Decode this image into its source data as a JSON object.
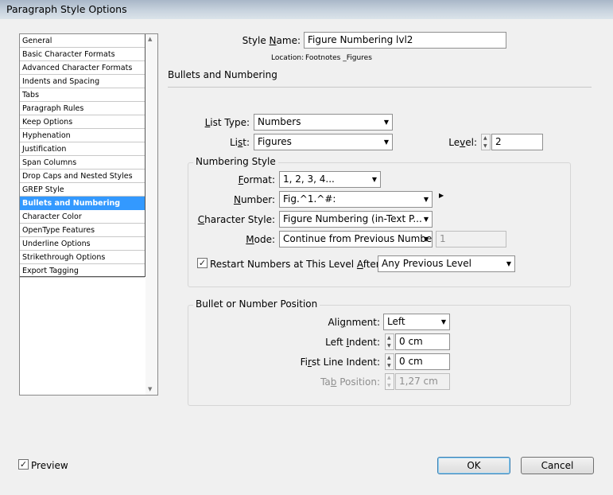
{
  "window": {
    "title": "Paragraph Style Options"
  },
  "sidebar": {
    "items": [
      {
        "label": "General"
      },
      {
        "label": "Basic Character Formats"
      },
      {
        "label": "Advanced Character Formats"
      },
      {
        "label": "Indents and Spacing"
      },
      {
        "label": "Tabs"
      },
      {
        "label": "Paragraph Rules"
      },
      {
        "label": "Keep Options"
      },
      {
        "label": "Hyphenation"
      },
      {
        "label": "Justification"
      },
      {
        "label": "Span Columns"
      },
      {
        "label": "Drop Caps and Nested Styles"
      },
      {
        "label": "GREP Style"
      },
      {
        "label": "Bullets and Numbering",
        "selected": true
      },
      {
        "label": "Character Color"
      },
      {
        "label": "OpenType Features"
      },
      {
        "label": "Underline Options"
      },
      {
        "label": "Strikethrough Options"
      },
      {
        "label": "Export Tagging"
      }
    ]
  },
  "header": {
    "style_name_label_pre": "Style ",
    "style_name_label_u": "N",
    "style_name_label_post": "ame:",
    "style_name_value": "Figure Numbering lvl2",
    "location_label": "Location:",
    "location_value": "Footnotes _Figures",
    "section_title": "Bullets and Numbering"
  },
  "list": {
    "type_label_u": "L",
    "type_label_post": "ist Type:",
    "type_value": "Numbers",
    "list_label_pre": "Li",
    "list_label_u": "s",
    "list_label_post": "t:",
    "list_value": "Figures",
    "level_label_pre": "Le",
    "level_label_u": "v",
    "level_label_post": "el:",
    "level_value": "2"
  },
  "numbering_style": {
    "title": "Numbering Style",
    "format_label_u": "F",
    "format_label_post": "ormat:",
    "format_value": "1, 2, 3, 4...",
    "number_label_u": "N",
    "number_label_post": "umber:",
    "number_value": "Fig.^1.^#:",
    "char_style_label_u": "C",
    "char_style_label_post": "haracter Style:",
    "char_style_value": "Figure Numbering (in-Text P...",
    "mode_label_u": "M",
    "mode_label_post": "ode:",
    "mode_value": "Continue from Previous Numbe",
    "mode_start_value": "1",
    "restart_checked": true,
    "restart_check_glyph": "✓",
    "restart_label_pre": "Restart Numbers at This Level ",
    "restart_label_u": "A",
    "restart_label_post": "fter:",
    "restart_value": "Any Previous Level"
  },
  "position": {
    "title": "Bullet or Number Position",
    "alignment_label_pre": "Ali",
    "alignment_label_u": "g",
    "alignment_label_post": "nment:",
    "alignment_value": "Left",
    "left_indent_label_pre": "Left ",
    "left_indent_label_u": "I",
    "left_indent_label_post": "ndent:",
    "left_indent_value": "0 cm",
    "first_line_label_pre": "Fi",
    "first_line_label_u": "r",
    "first_line_label_post": "st Line Indent:",
    "first_line_value": "0 cm",
    "tab_pos_label_pre": "Ta",
    "tab_pos_label_u": "b",
    "tab_pos_label_post": " Position:",
    "tab_pos_value": "1,27 cm"
  },
  "footer": {
    "preview_checked": true,
    "preview_check_glyph": "✓",
    "preview_label": "Preview",
    "ok_label": "OK",
    "cancel_label": "Cancel"
  },
  "icons": {
    "dropdown": "▼",
    "spin_up": "▲",
    "spin_down": "▼",
    "scroll_up": "▲",
    "scroll_down": "▼",
    "flyout": "▶"
  }
}
